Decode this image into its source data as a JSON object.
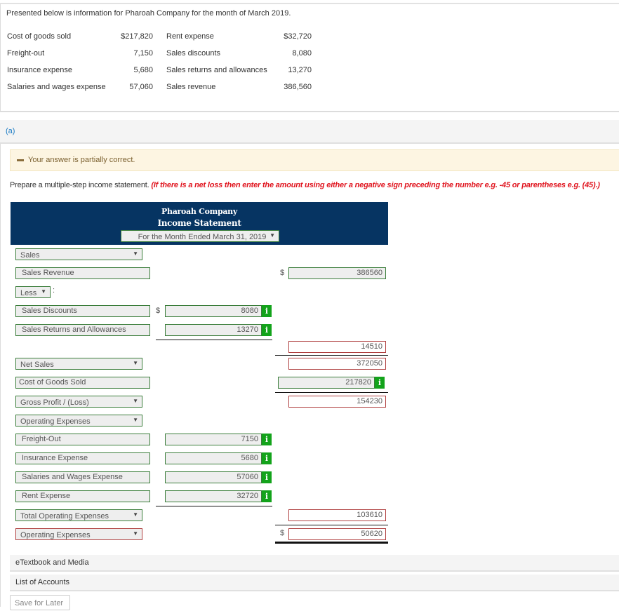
{
  "problem": {
    "intro": "Presented below is information for Pharoah Company for the month of March 2019.",
    "given": [
      {
        "label": "Cost of goods sold",
        "value": "$217,820",
        "label2": "Rent expense",
        "value2": "$32,720"
      },
      {
        "label": "Freight-out",
        "value": "7,150",
        "label2": "Sales discounts",
        "value2": "8,080"
      },
      {
        "label": "Insurance expense",
        "value": "5,680",
        "label2": "Sales returns and allowances",
        "value2": "13,270"
      },
      {
        "label": "Salaries and wages expense",
        "value": "57,060",
        "label2": "Sales revenue",
        "value2": "386,560"
      }
    ]
  },
  "part": {
    "label": "(a)",
    "feedback": "Your answer is partially correct.",
    "instruction": "Prepare a multiple-step income statement.",
    "instruction_note": "(If there is a net loss then enter the amount using either a negative sign preceding the number e.g. -45 or parentheses e.g. (45).)"
  },
  "statement": {
    "company": "Pharoah Company",
    "title": "Income Statement",
    "period": "For the Month Ended March 31, 2019",
    "currency": "$",
    "info_glyph": "i",
    "sales_heading": "Sales",
    "sales_revenue": {
      "label": "Sales Revenue",
      "amount": "386560"
    },
    "less_label": "Less",
    "colon": ":",
    "deductions": [
      {
        "label": "Sales Discounts",
        "amount": "8080"
      },
      {
        "label": "Sales Returns and Allowances",
        "amount": "13270"
      }
    ],
    "deductions_total": "14510",
    "net_sales": {
      "label": "Net Sales",
      "amount": "372050"
    },
    "cogs": {
      "label": "Cost of Goods Sold",
      "amount": "217820"
    },
    "gross_profit": {
      "label": "Gross Profit / (Loss)",
      "amount": "154230"
    },
    "opex_heading": "Operating Expenses",
    "opex": [
      {
        "label": "Freight-Out",
        "amount": "7150"
      },
      {
        "label": "Insurance Expense",
        "amount": "5680"
      },
      {
        "label": "Salaries and Wages Expense",
        "amount": "57060"
      },
      {
        "label": "Rent Expense",
        "amount": "32720"
      }
    ],
    "total_opex": {
      "label": "Total Operating Expenses",
      "amount": "103610"
    },
    "final": {
      "label": "Operating Expenses",
      "amount": "50620"
    }
  },
  "footer": {
    "etextbook": "eTextbook and Media",
    "accounts": "List of Accounts",
    "save": "Save for Later"
  }
}
